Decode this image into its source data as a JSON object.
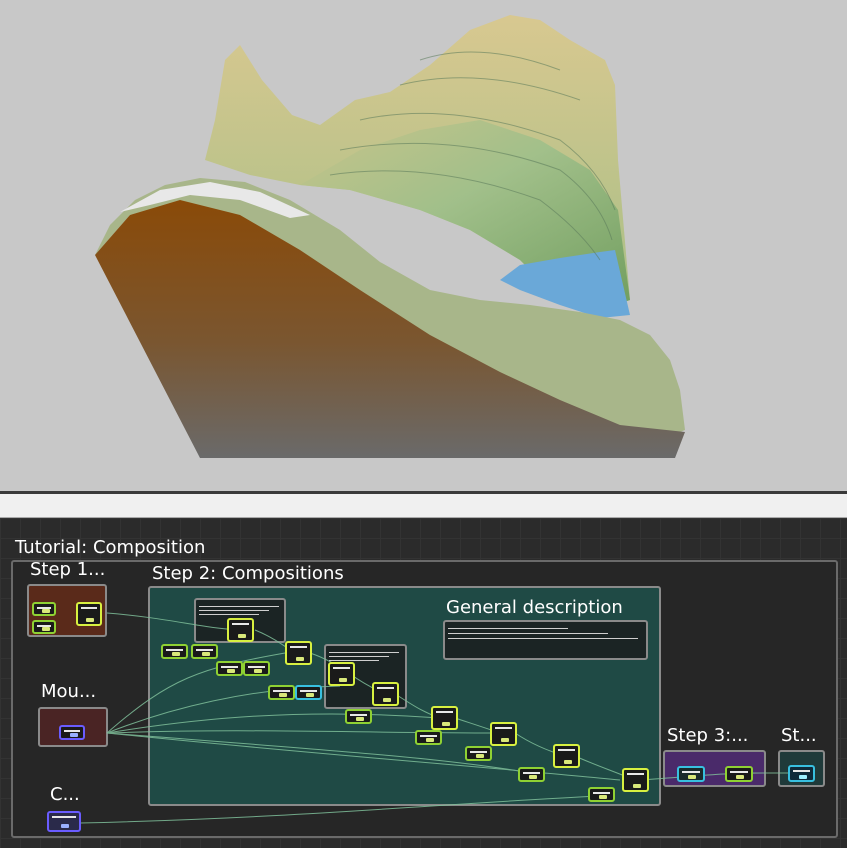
{
  "graph": {
    "root_title": "Tutorial: Composition",
    "groups": {
      "step1": "Step 1...",
      "step2": "Step 2: Compositions",
      "general": "General description",
      "mouse": "Mou...",
      "c": "C...",
      "step3": "Step 3:...",
      "step4": "St..."
    }
  },
  "colors": {
    "viewport_bg": "#c8c8c8",
    "graph_bg": "#2b2b2b",
    "step2_group": "#1f4a45",
    "step1_group": "#5a2a1a",
    "mouse_group": "#4a2424",
    "step3_group": "#4a2a6a",
    "step4_group": "#1f3a3a",
    "node_green": "#8fd133",
    "node_blue": "#6a5cff",
    "node_cyan": "#38c0e0",
    "water": "#6aa8d8"
  }
}
